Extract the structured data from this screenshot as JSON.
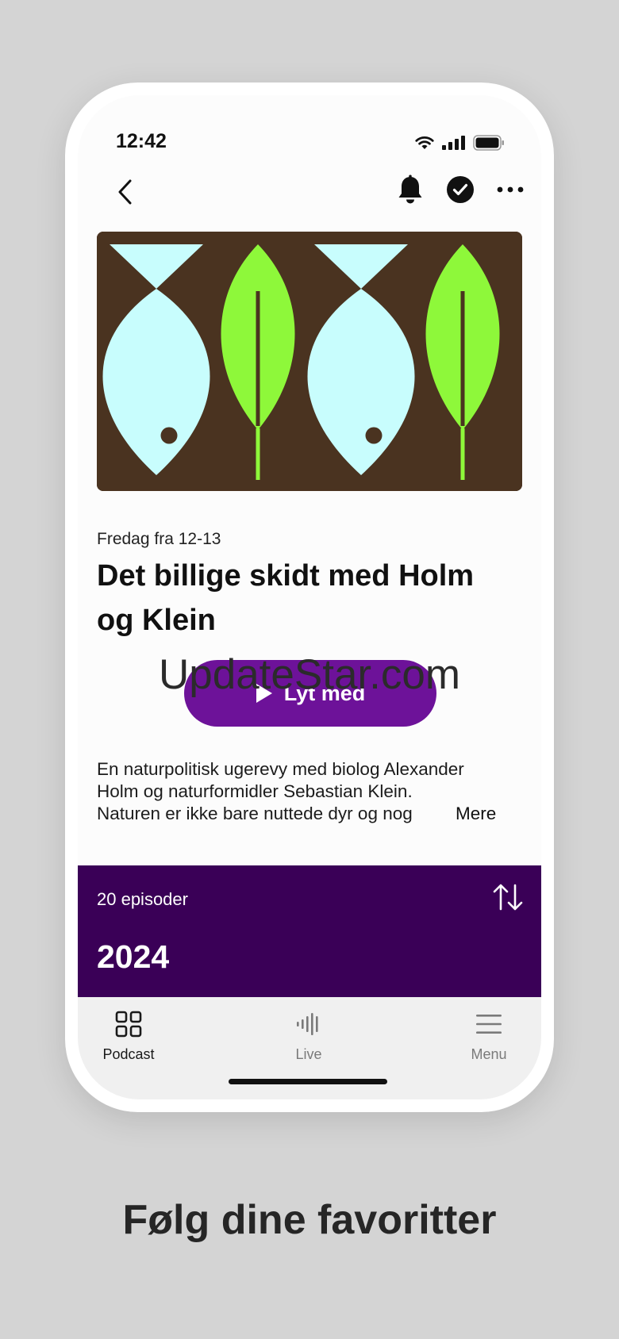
{
  "status_bar": {
    "time": "12:42"
  },
  "colors": {
    "accent_button": "#6d1299",
    "episodes_band": "#3a0057",
    "cover_bg": "#4a3320",
    "cover_fish": "#c8fdfd",
    "cover_leaf": "#8ef83a"
  },
  "nav": {
    "back_icon": "chevron-left-icon",
    "bell_icon": "bell-icon",
    "followed_icon": "check-circle-icon",
    "more_icon": "more-horizontal-icon"
  },
  "program": {
    "schedule": "Fredag fra 12-13",
    "title": "Det billige skidt med Holm og Klein",
    "listen_label": "Lyt med",
    "description_line1": "En naturpolitisk ugerevy med biolog Alexander",
    "description_line2": "Holm og naturformidler Sebastian Klein.",
    "description_line3": "Naturen er ikke bare nuttede dyr og nog",
    "more_label": "Mere"
  },
  "watermark": "UpdateStar.com",
  "episodes": {
    "count_label": "20 episoder",
    "sort_icon": "sort-arrows-icon",
    "year": "2024"
  },
  "tabs": [
    {
      "label": "Podcast",
      "icon": "grid-icon",
      "active": true
    },
    {
      "label": "Live",
      "icon": "live-bars-icon",
      "active": false
    },
    {
      "label": "Menu",
      "icon": "menu-icon",
      "active": false
    }
  ],
  "caption": "Følg dine favoritter"
}
